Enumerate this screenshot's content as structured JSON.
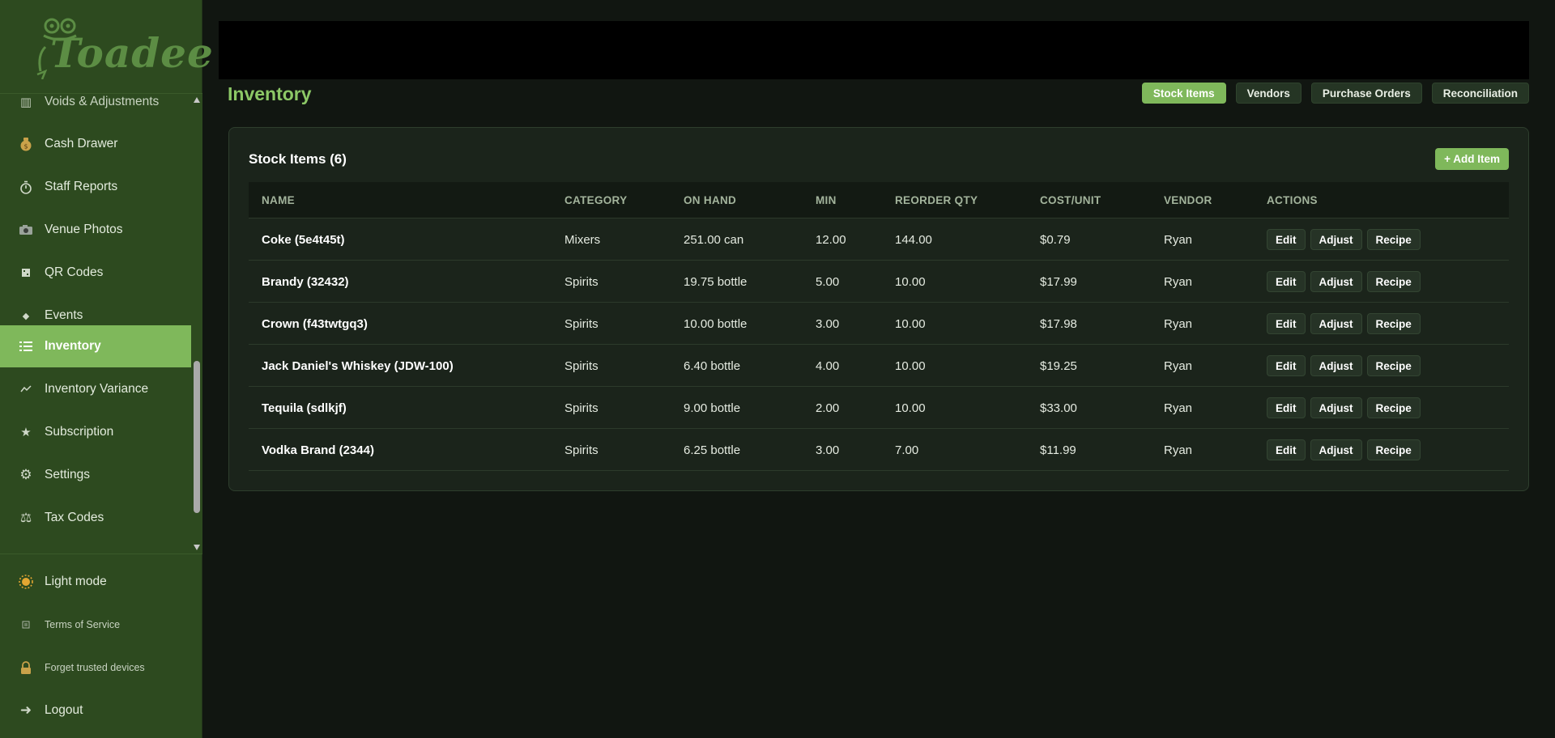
{
  "app": {
    "logo_text": "Toadee"
  },
  "sidebar": {
    "items": [
      {
        "label": "Voids & Adjustments",
        "icon": "chart-icon"
      },
      {
        "label": "Cash Drawer",
        "icon": "money-bag-icon"
      },
      {
        "label": "Staff Reports",
        "icon": "stopwatch-icon"
      },
      {
        "label": "Venue Photos",
        "icon": "camera-icon"
      },
      {
        "label": "QR Codes",
        "icon": "qr-icon"
      },
      {
        "label": "Events",
        "icon": "diamond-icon"
      },
      {
        "label": "Inventory",
        "icon": "list-icon",
        "active": true
      },
      {
        "label": "Inventory Variance",
        "icon": "variance-icon"
      },
      {
        "label": "Subscription",
        "icon": "star-icon"
      },
      {
        "label": "Settings",
        "icon": "gear-icon"
      },
      {
        "label": "Tax Codes",
        "icon": "scales-icon"
      }
    ],
    "bottom": [
      {
        "label": "Light mode",
        "icon": "sun-icon"
      },
      {
        "label": "Terms of Service",
        "icon": "document-icon"
      },
      {
        "label": "Forget trusted devices",
        "icon": "lock-icon"
      },
      {
        "label": "Logout",
        "icon": "arrow-right-icon"
      }
    ]
  },
  "page": {
    "title": "Inventory",
    "tabs": [
      {
        "label": "Stock Items",
        "active": true
      },
      {
        "label": "Vendors"
      },
      {
        "label": "Purchase Orders"
      },
      {
        "label": "Reconciliation"
      }
    ]
  },
  "card": {
    "title": "Stock Items (6)",
    "add_label": "+ Add Item"
  },
  "table": {
    "columns": [
      "NAME",
      "CATEGORY",
      "ON HAND",
      "MIN",
      "REORDER QTY",
      "COST/UNIT",
      "VENDOR",
      "ACTIONS"
    ],
    "action_labels": [
      "Edit",
      "Adjust",
      "Recipe"
    ],
    "rows": [
      {
        "name": "Coke (5e4t45t)",
        "category": "Mixers",
        "on_hand": "251.00 can",
        "min": "12.00",
        "reorder": "144.00",
        "cost": "$0.79",
        "vendor": "Ryan"
      },
      {
        "name": "Brandy (32432)",
        "category": "Spirits",
        "on_hand": "19.75 bottle",
        "min": "5.00",
        "reorder": "10.00",
        "cost": "$17.99",
        "vendor": "Ryan"
      },
      {
        "name": "Crown (f43twtgq3)",
        "category": "Spirits",
        "on_hand": "10.00 bottle",
        "min": "3.00",
        "reorder": "10.00",
        "cost": "$17.98",
        "vendor": "Ryan"
      },
      {
        "name": "Jack Daniel's Whiskey (JDW-100)",
        "category": "Spirits",
        "on_hand": "6.40 bottle",
        "min": "4.00",
        "reorder": "10.00",
        "cost": "$19.25",
        "vendor": "Ryan"
      },
      {
        "name": "Tequila (sdlkjf)",
        "category": "Spirits",
        "on_hand": "9.00 bottle",
        "min": "2.00",
        "reorder": "10.00",
        "cost": "$33.00",
        "vendor": "Ryan"
      },
      {
        "name": "Vodka Brand (2344)",
        "category": "Spirits",
        "on_hand": "6.25 bottle",
        "min": "3.00",
        "reorder": "7.00",
        "cost": "$11.99",
        "vendor": "Ryan"
      }
    ]
  },
  "colors": {
    "accent": "#7fb85b",
    "sidebar_bg": "#2d4a1f",
    "main_bg": "#111611",
    "card_bg": "#1b241b",
    "title_green": "#8cc866"
  }
}
